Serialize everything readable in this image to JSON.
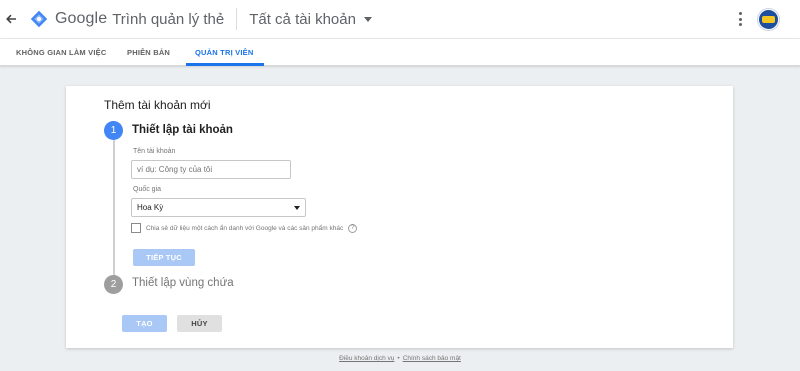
{
  "header": {
    "back_icon": "arrow-back-icon",
    "logo_icon": "tag-manager-logo-icon",
    "brand": "Google",
    "product": "Trình quản lý thẻ",
    "account_selector": "Tất cả tài khoản",
    "more_icon": "more-vert-icon"
  },
  "tabs": [
    {
      "label": "KHÔNG GIAN LÀM VIỆC",
      "active": false
    },
    {
      "label": "PHIÊN BẢN",
      "active": false
    },
    {
      "label": "QUẢN TRỊ VIÊN",
      "active": true
    }
  ],
  "form": {
    "title": "Thêm tài khoản mới",
    "step1": {
      "number": "1",
      "title": "Thiết lập tài khoản",
      "account_name_label": "Tên tài khoản",
      "account_name_placeholder": "ví dụ: Công ty của tôi",
      "account_name_value": "",
      "country_label": "Quốc gia",
      "country_value": "Hoa Kỳ",
      "share_data_label": "Chia sẻ dữ liệu một cách ẩn danh với Google và các sản phẩm khác",
      "share_data_checked": false,
      "help_icon": "?",
      "continue_button": "TIẾP TỤC"
    },
    "step2": {
      "number": "2",
      "title": "Thiết lập vùng chứa"
    },
    "create_button": "TẠO",
    "cancel_button": "HỦY"
  },
  "footer": {
    "terms_link": "Điều khoản dịch vụ",
    "separator": "•",
    "privacy_link": "Chính sách bảo mật"
  },
  "colors": {
    "accent": "#1a73e8",
    "step_active": "#4285f4",
    "step_inactive": "#9e9e9e",
    "disabled_button": "#a9c8f5",
    "background": "#eceff1"
  }
}
